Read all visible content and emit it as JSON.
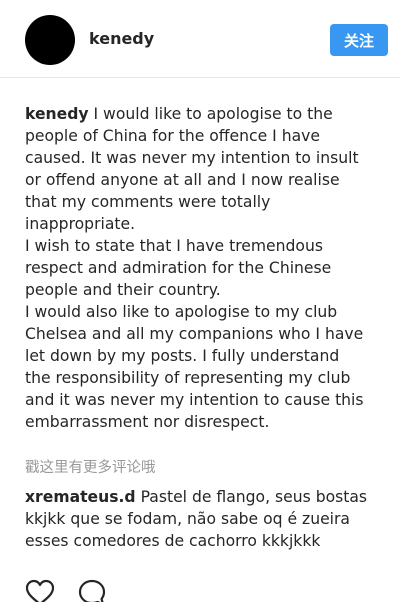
{
  "header": {
    "username": "kenedy",
    "follow_label": "关注"
  },
  "caption": {
    "author": "kenedy",
    "lines": [
      " I would like to apologise to the",
      "people of China for the offence I have",
      "caused. It was never my intention to insult",
      "or offend anyone at all and I now realise",
      "that my comments were totally",
      "inappropriate.",
      "I wish to state that I have tremendous",
      "respect and admiration for the Chinese",
      "people and their country.",
      "I would also like to apologise to my club",
      "Chelsea and all my companions who I have",
      "let down by my posts. I fully understand",
      "the responsibility of representing my club",
      "and it was never my intention to cause this",
      "embarrassment nor disrespect."
    ]
  },
  "more_comments": "戳这里有更多评论哦",
  "comment": {
    "author": "xremateus.d",
    "lines": [
      " Pastel de flango, seus bostas",
      "kkjkk que se fodam, não sabe oq é zueira",
      "esses comedores de cachorro kkkjkkk"
    ]
  },
  "icons": {
    "like": "heart-icon",
    "comment": "comment-icon"
  }
}
